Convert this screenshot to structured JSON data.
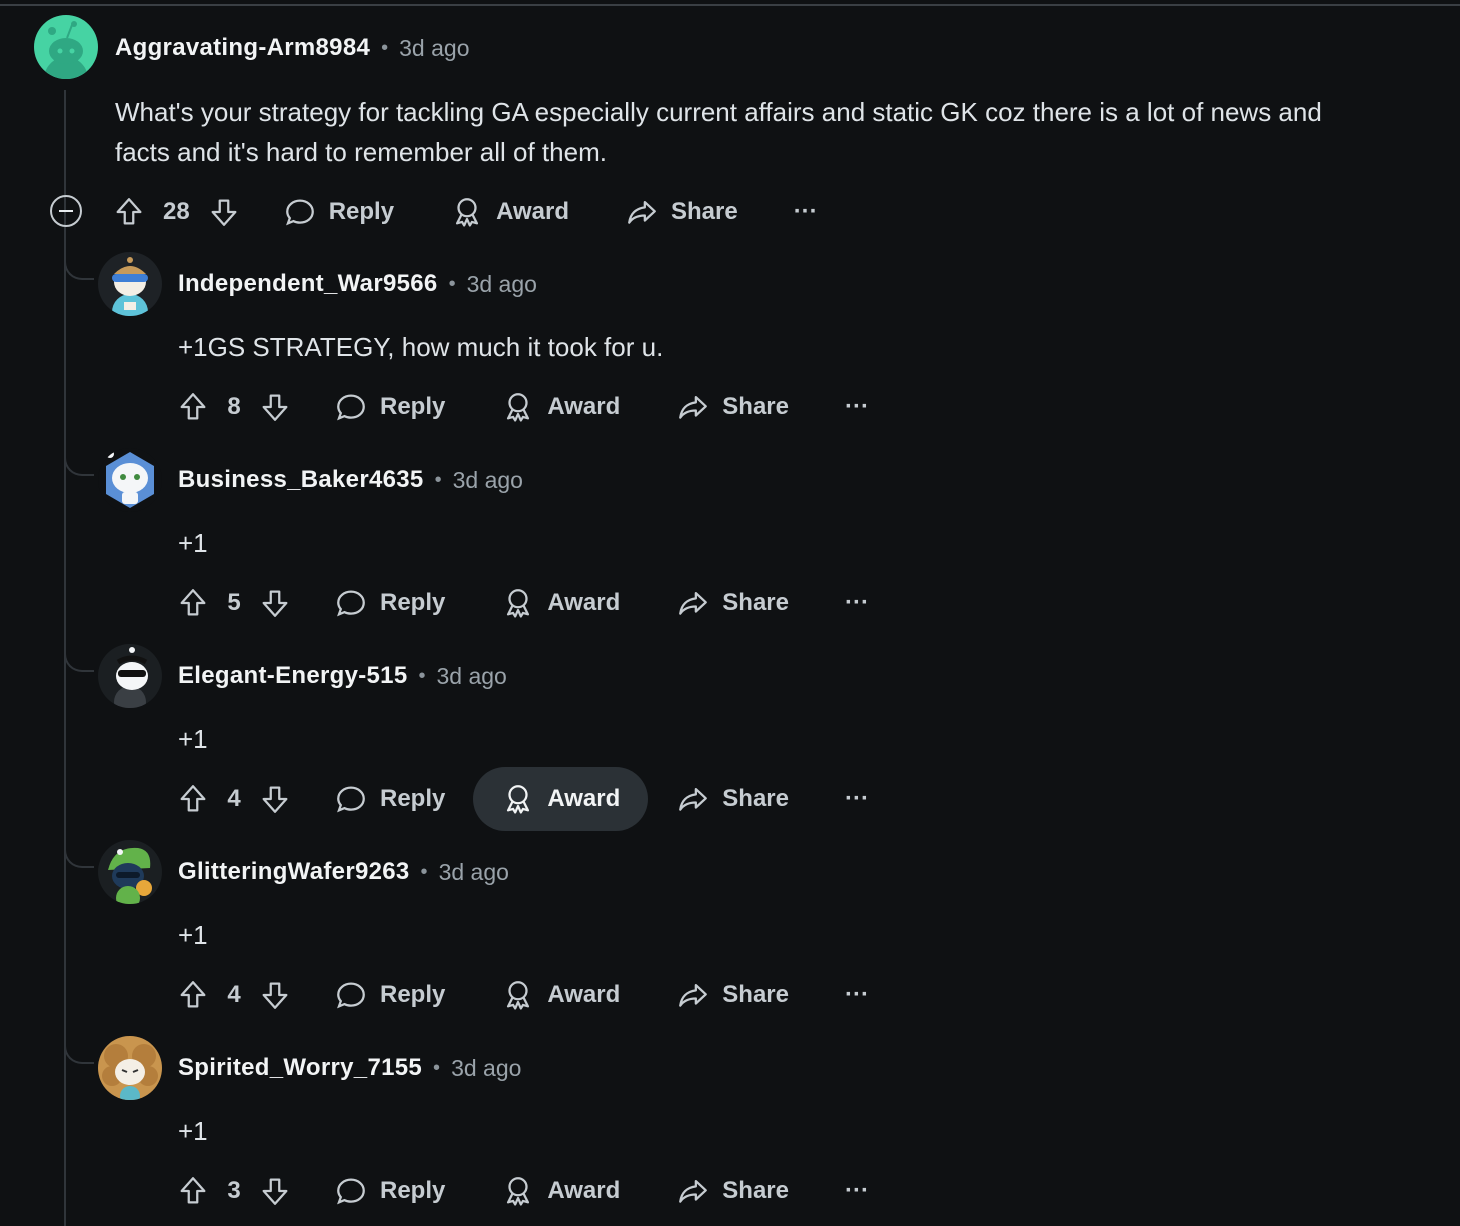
{
  "parent": {
    "author": "Aggravating-Arm8984",
    "time": "3d ago",
    "body_lines": [
      "What's your strategy for tackling GA especially current affairs and static GK coz there is a lot of news and",
      "facts and it's hard to remember all of them."
    ],
    "score": "28",
    "avatar": "snoo-avatar-teal"
  },
  "labels": {
    "reply": "Reply",
    "award": "Award",
    "share": "Share",
    "more": "···"
  },
  "replies": [
    {
      "author": "Independent_War9566",
      "time": "3d ago",
      "body": "+1GS STRATEGY, how much it took for u.",
      "score": "8",
      "avatar": "snoo-goggles-avatar"
    },
    {
      "author": "Business_Baker4635",
      "time": "3d ago",
      "body": "+1",
      "score": "5",
      "avatar": "snoo-helmet-avatar"
    },
    {
      "author": "Elegant-Energy-515",
      "time": "3d ago",
      "body": "+1",
      "score": "4",
      "avatar": "snoo-sunglasses-avatar",
      "award_active": true
    },
    {
      "author": "GlitteringWafer9263",
      "time": "3d ago",
      "body": "+1",
      "score": "4",
      "avatar": "snoo-dino-avatar"
    },
    {
      "author": "Spirited_Worry_7155",
      "time": "3d ago",
      "body": "+1",
      "score": "3",
      "avatar": "snoo-curly-hair-avatar"
    }
  ],
  "colors": {
    "background": "#0f1113",
    "text": "#e8ecef",
    "muted": "#9aa3aa",
    "active_pill": "#2b3136",
    "parent_avatar": "#46d3a3"
  }
}
